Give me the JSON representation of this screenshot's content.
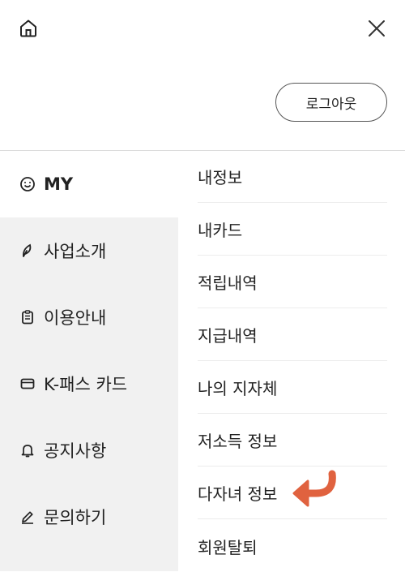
{
  "header": {
    "logout_label": "로그아웃"
  },
  "sidebar": {
    "items": [
      {
        "label": "MY",
        "icon": "smile-icon",
        "active": true
      },
      {
        "label": "사업소개",
        "icon": "leaf-icon"
      },
      {
        "label": "이용안내",
        "icon": "clipboard-icon"
      },
      {
        "label": "K-패스 카드",
        "icon": "card-icon"
      },
      {
        "label": "공지사항",
        "icon": "bell-icon"
      },
      {
        "label": "문의하기",
        "icon": "pencil-icon"
      }
    ]
  },
  "menu": {
    "items": [
      {
        "label": "내정보"
      },
      {
        "label": "내카드"
      },
      {
        "label": "적립내역"
      },
      {
        "label": "지급내역"
      },
      {
        "label": "나의 지자체"
      },
      {
        "label": "저소득 정보"
      },
      {
        "label": "다자녀 정보"
      },
      {
        "label": "회원탈퇴"
      }
    ]
  },
  "colors": {
    "accent_arrow": "#e0623f",
    "sidebar_bg": "#f1f1f1"
  }
}
